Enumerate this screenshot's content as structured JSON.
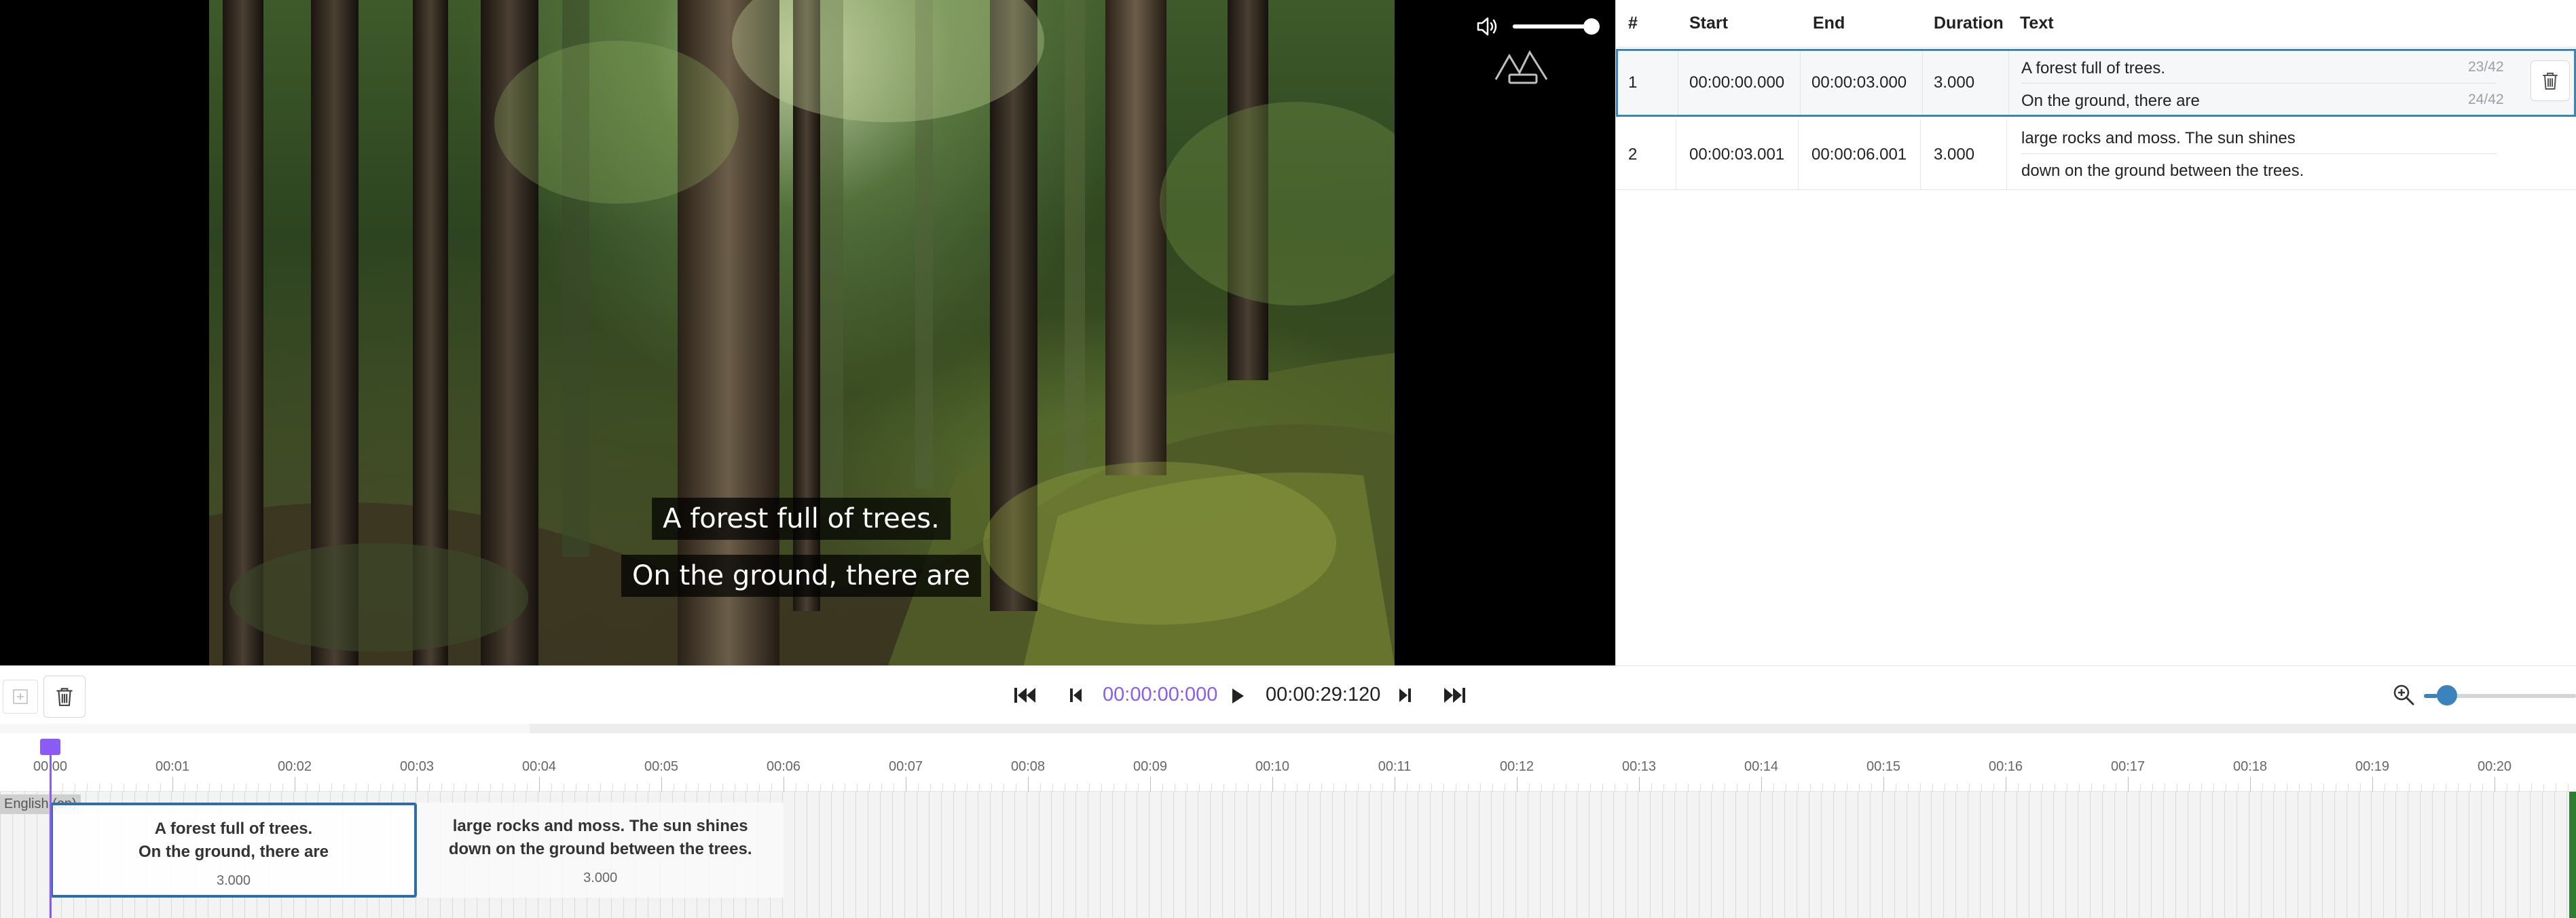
{
  "video": {
    "subtitle_lines": [
      "A forest full of trees.",
      "On the ground, there are"
    ],
    "volume_fraction": 1.0
  },
  "table": {
    "headers": {
      "index": "#",
      "start": "Start",
      "end": "End",
      "duration": "Duration",
      "text": "Text"
    },
    "rows": [
      {
        "index": "1",
        "start": "00:00:00.000",
        "end": "00:00:03.000",
        "duration": "3.000",
        "lines": [
          "A forest full of trees.",
          "On the ground, there are"
        ],
        "counts": [
          "23/42",
          "24/42"
        ],
        "selected": true
      },
      {
        "index": "2",
        "start": "00:00:03.001",
        "end": "00:00:06.001",
        "duration": "3.000",
        "lines": [
          "large rocks and moss. The sun shines",
          "down on the ground between the trees."
        ],
        "counts": [
          "",
          ""
        ],
        "selected": false
      }
    ]
  },
  "toolbar": {
    "current_time": "00:00:00:000",
    "total_time": "00:00:29:120",
    "zoom_fraction": 0.07
  },
  "timeline": {
    "track_label": "English (en)",
    "ticks": [
      "00:00",
      "00:01",
      "00:02",
      "00:03",
      "00:04",
      "00:05",
      "00:06",
      "00:07",
      "00:08",
      "00:09",
      "00:10",
      "00:11",
      "00:12",
      "00:13",
      "00:14",
      "00:15",
      "00:16",
      "00:17",
      "00:18",
      "00:19",
      "00:20"
    ],
    "blocks": [
      {
        "lines": [
          "A forest full of trees.",
          "On the ground, there are"
        ],
        "duration": "3.000",
        "start_sec": 0,
        "end_sec": 3.0,
        "selected": true
      },
      {
        "lines": [
          "large rocks and moss. The sun shines",
          "down on the ground between the trees."
        ],
        "duration": "3.000",
        "start_sec": 3.001,
        "end_sec": 6.001,
        "selected": false
      }
    ],
    "playhead_sec": 0
  },
  "colors": {
    "accent": "#8a5cf5",
    "selection": "#3b83bd",
    "zoom": "#3b83bd",
    "end_marker": "#2e7d32"
  },
  "icons": {
    "volume": "volume-icon",
    "row_delete": "trash-icon",
    "add": "add-icon",
    "delete": "trash-icon",
    "skip_start": "skip-to-start-icon",
    "step_back": "step-back-icon",
    "play": "play-icon",
    "step_forward": "step-forward-icon",
    "skip_end": "skip-to-end-icon",
    "zoom": "zoom-in-icon"
  }
}
